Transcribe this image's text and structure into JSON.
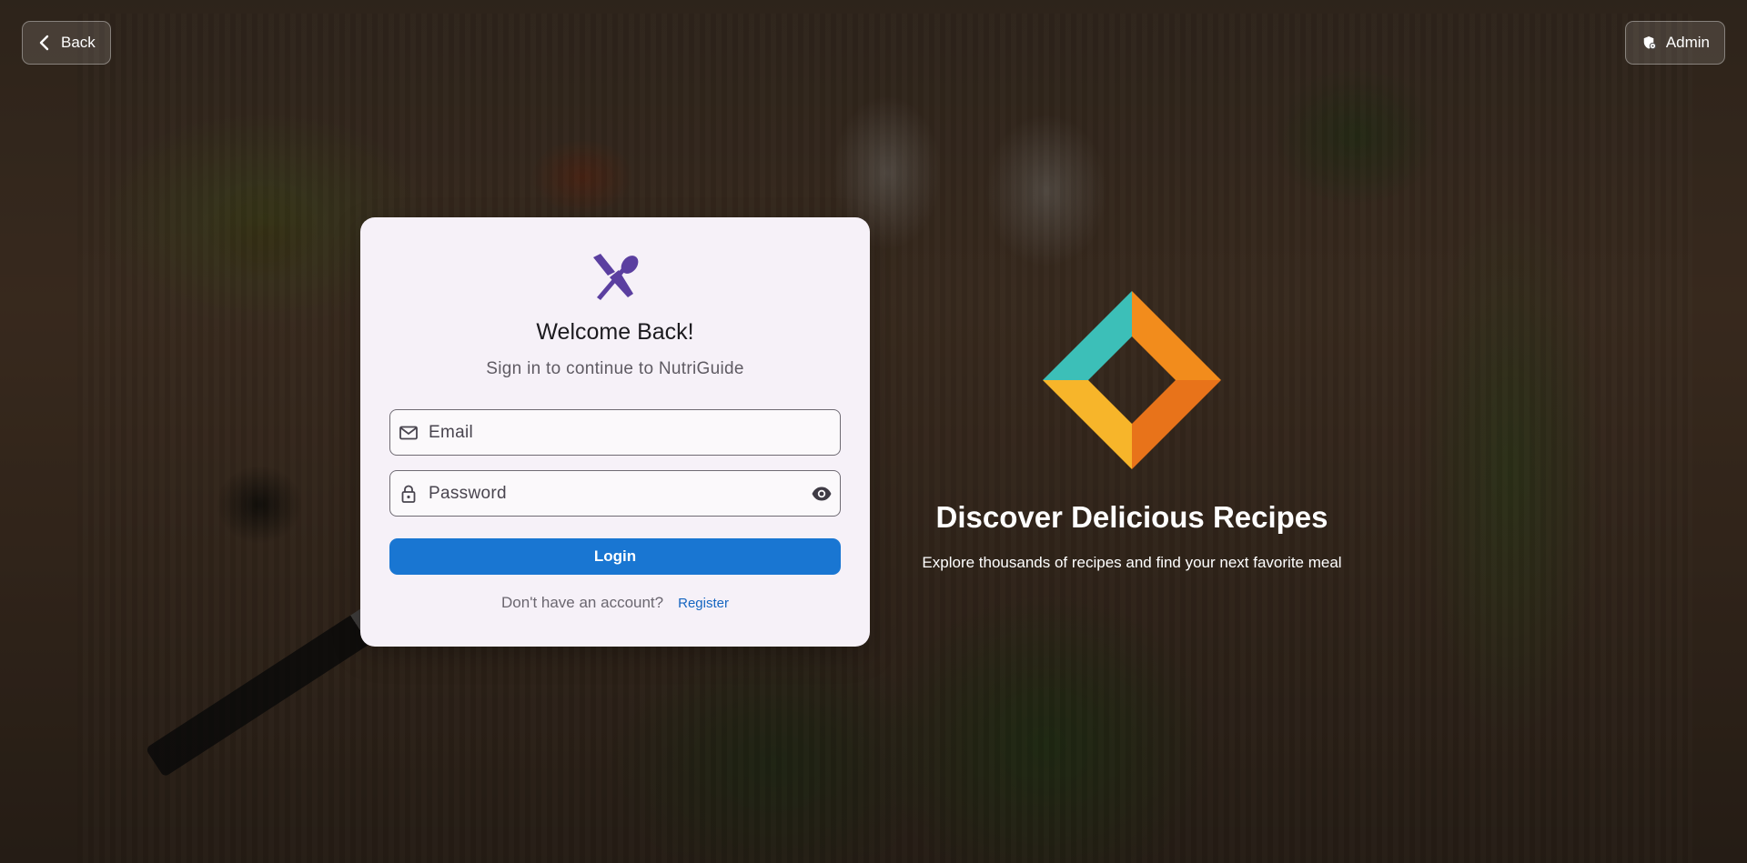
{
  "header": {
    "back_label": "Back",
    "admin_label": "Admin"
  },
  "login_card": {
    "logo_icon": "fork-spoon-icon",
    "title": "Welcome Back!",
    "subtitle": "Sign in to continue to NutriGuide",
    "email_placeholder": "Email",
    "email_value": "",
    "password_placeholder": "Password",
    "password_value": "",
    "login_label": "Login",
    "register_prompt": "Don't have an account?",
    "register_label": "Register"
  },
  "promo": {
    "title": "Discover Delicious Recipes",
    "subtitle": "Explore thousands of recipes and find your next favorite meal"
  },
  "colors": {
    "primary": "#1976d2",
    "logo_purple": "#5b3fa0",
    "card_bg": "#f6f1f8",
    "diamond_teal": "#3cbfb8",
    "diamond_orange": "#f28c1c",
    "diamond_yellow": "#f7b52a"
  }
}
